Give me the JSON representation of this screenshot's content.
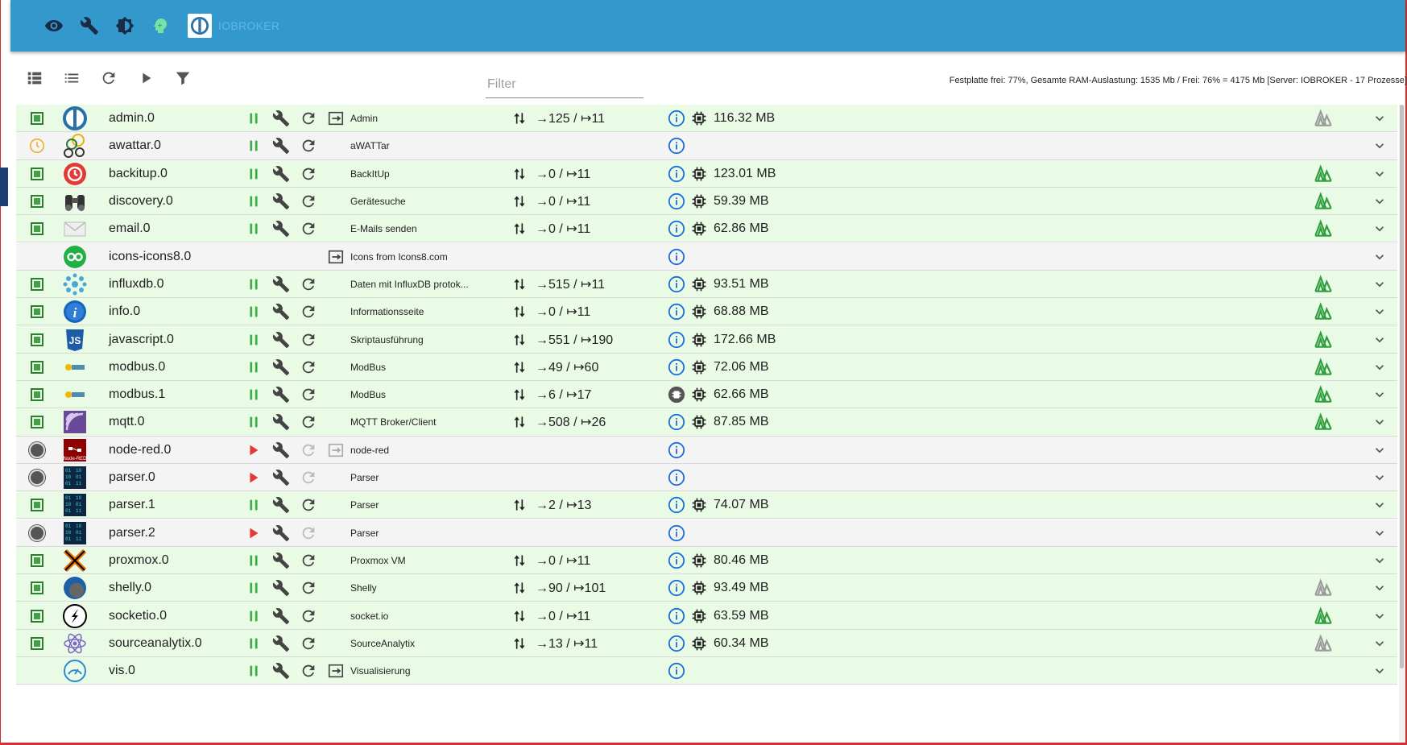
{
  "appbar": {
    "title": "IOBROKER",
    "buttons": [
      {
        "icon": "eye-icon"
      },
      {
        "icon": "wrench-icon"
      },
      {
        "icon": "brightness-icon"
      },
      {
        "icon": "expert-mode-icon"
      }
    ],
    "colors": {
      "bar": "#3399cc",
      "expert": "#76e3a1"
    }
  },
  "toolbar": {
    "filter_placeholder": "Filter",
    "filter_value": "",
    "status": "Festplatte frei: 77%, Gesamte RAM-Auslastung: 1535 Mb / Frei: 76% = 4175 Mb [Server: IOBROKER - 17 Prozesse]",
    "tools": [
      "list-view-icon",
      "list-detail-icon",
      "refresh-icon",
      "play-icon",
      "filter-icon"
    ]
  },
  "colors": {
    "running_row": "#e9fbe5",
    "stopped_row": "#f4f4f4",
    "accent_green": "#3dad47",
    "stop_red": "#e53935",
    "info_blue": "#1e6fd9",
    "signal_green": "#2e9e3e",
    "signal_grey": "#9a9a9a"
  },
  "instances": [
    {
      "name": "admin.0",
      "title": "Admin",
      "status": "running",
      "events": "→125 / ↦11",
      "memory": "116.32 MB",
      "icon": "admin-logo",
      "signal": "grey",
      "link": true,
      "eventsShown": true
    },
    {
      "name": "awattar.0",
      "title": "aWATTar",
      "status": "scheduled",
      "events": "",
      "memory": "",
      "icon": "awattar-logo",
      "signal": "none",
      "link": false,
      "eventsShown": false
    },
    {
      "name": "backitup.0",
      "title": "BackItUp",
      "status": "running",
      "events": "→0 / ↦11",
      "memory": "123.01 MB",
      "icon": "backitup-logo",
      "signal": "green",
      "link": false,
      "eventsShown": true
    },
    {
      "name": "discovery.0",
      "title": "Gerätesuche",
      "status": "running",
      "events": "→0 / ↦11",
      "memory": "59.39 MB",
      "icon": "binoculars-logo",
      "signal": "green",
      "link": false,
      "eventsShown": true
    },
    {
      "name": "email.0",
      "title": "E-Mails senden",
      "status": "running",
      "events": "→0 / ↦11",
      "memory": "62.86 MB",
      "icon": "envelope-logo",
      "signal": "green",
      "link": false,
      "eventsShown": true
    },
    {
      "name": "icons-icons8.0",
      "title": "Icons from Icons8.com",
      "status": "none",
      "events": "",
      "memory": "",
      "icon": "icons8-logo",
      "signal": "none",
      "link": true,
      "eventsShown": false
    },
    {
      "name": "influxdb.0",
      "title": "Daten mit InfluxDB protok...",
      "status": "running",
      "events": "→515 / ↦11",
      "memory": "93.51 MB",
      "icon": "influxdb-logo",
      "signal": "green",
      "link": false,
      "eventsShown": true
    },
    {
      "name": "info.0",
      "title": "Informationsseite",
      "status": "running",
      "events": "→0 / ↦11",
      "memory": "68.88 MB",
      "icon": "info-logo",
      "signal": "green",
      "link": false,
      "eventsShown": true
    },
    {
      "name": "javascript.0",
      "title": "Skriptausführung",
      "status": "running",
      "events": "→551 / ↦190",
      "memory": "172.66 MB",
      "icon": "javascript-logo",
      "signal": "green",
      "link": false,
      "eventsShown": true
    },
    {
      "name": "modbus.0",
      "title": "ModBus",
      "status": "running",
      "events": "→49 / ↦60",
      "memory": "72.06 MB",
      "icon": "modbus-logo",
      "signal": "green",
      "link": false,
      "eventsShown": true
    },
    {
      "name": "modbus.1",
      "title": "ModBus",
      "status": "running",
      "events": "→6 / ↦17",
      "memory": "62.66 MB",
      "icon": "modbus-logo",
      "signal": "green",
      "link": false,
      "eventsShown": true,
      "infoAlt": true
    },
    {
      "name": "mqtt.0",
      "title": "MQTT Broker/Client",
      "status": "running",
      "events": "→508 / ↦26",
      "memory": "87.85 MB",
      "icon": "mqtt-logo",
      "signal": "green",
      "link": false,
      "eventsShown": true
    },
    {
      "name": "node-red.0",
      "title": "node-red",
      "status": "stopped",
      "events": "",
      "memory": "",
      "icon": "node-red-logo",
      "signal": "none",
      "link": true,
      "eventsShown": false
    },
    {
      "name": "parser.0",
      "title": "Parser",
      "status": "stopped",
      "events": "",
      "memory": "",
      "icon": "parser-logo",
      "signal": "none",
      "link": false,
      "eventsShown": false
    },
    {
      "name": "parser.1",
      "title": "Parser",
      "status": "running",
      "events": "→2 / ↦13",
      "memory": "74.07 MB",
      "icon": "parser-logo",
      "signal": "none",
      "link": false,
      "eventsShown": true
    },
    {
      "name": "parser.2",
      "title": "Parser",
      "status": "stopped",
      "events": "",
      "memory": "",
      "icon": "parser-logo",
      "signal": "none",
      "link": false,
      "eventsShown": false
    },
    {
      "name": "proxmox.0",
      "title": "Proxmox VM",
      "status": "running",
      "events": "→0 / ↦11",
      "memory": "80.46 MB",
      "icon": "proxmox-logo",
      "signal": "none",
      "link": false,
      "eventsShown": true
    },
    {
      "name": "shelly.0",
      "title": "Shelly",
      "status": "running",
      "events": "→90 / ↦101",
      "memory": "93.49 MB",
      "icon": "shelly-logo",
      "signal": "grey",
      "link": false,
      "eventsShown": true
    },
    {
      "name": "socketio.0",
      "title": "socket.io",
      "status": "running",
      "events": "→0 / ↦11",
      "memory": "63.59 MB",
      "icon": "socketio-logo",
      "signal": "green",
      "link": false,
      "eventsShown": true
    },
    {
      "name": "sourceanalytix.0",
      "title": "SourceAnalytix",
      "status": "running",
      "events": "→13 / ↦11",
      "memory": "60.34 MB",
      "icon": "sourceanalytix-logo",
      "signal": "grey",
      "link": false,
      "eventsShown": true
    },
    {
      "name": "vis.0",
      "title": "Visualisierung",
      "status": "running-partial",
      "events": "",
      "memory": "",
      "icon": "vis-logo",
      "signal": "none",
      "link": true,
      "eventsShown": false
    }
  ]
}
